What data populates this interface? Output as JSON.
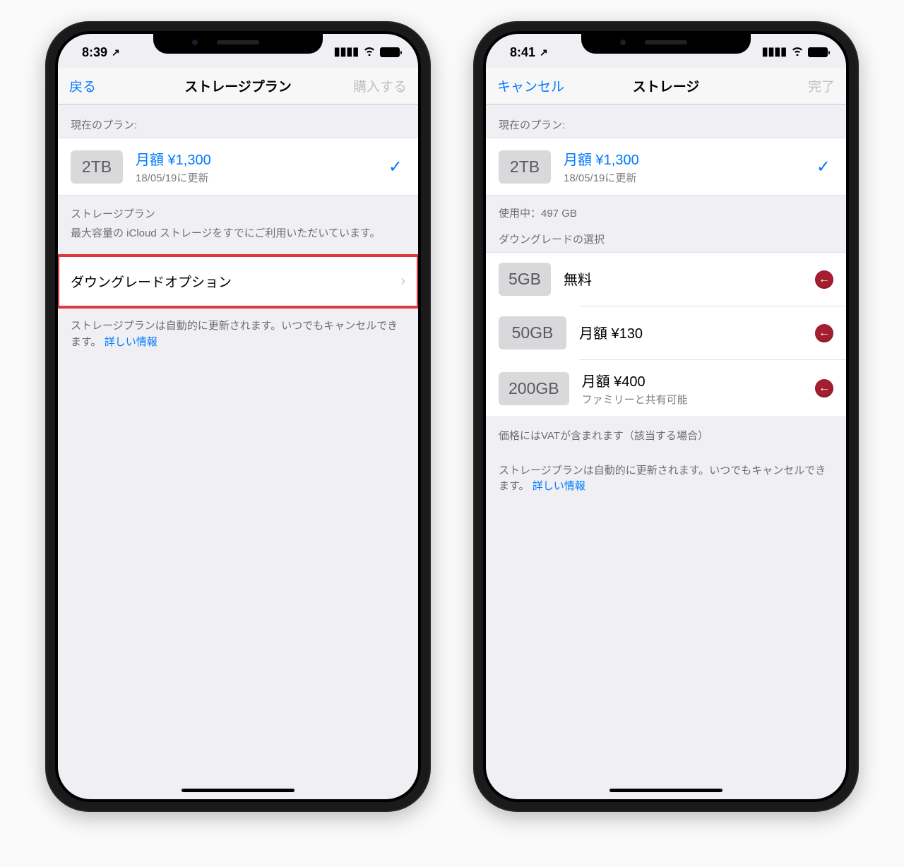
{
  "left": {
    "status": {
      "time": "8:39",
      "loc": "↗"
    },
    "nav": {
      "back": "戻る",
      "title": "ストレージプラン",
      "right": "購入する"
    },
    "currentHeader": "現在のプラン:",
    "current": {
      "size": "2TB",
      "price": "月額 ¥1,300",
      "renew": "18/05/19に更新"
    },
    "storageLabel": "ストレージプラン",
    "storageDesc": "最大容量の iCloud ストレージをすでにご利用いただいています。",
    "downgradeOption": "ダウングレードオプション",
    "footer1": "ストレージプランは自動的に更新されます。いつでもキャンセルできます。",
    "footerLink": "詳しい情報"
  },
  "right": {
    "status": {
      "time": "8:41",
      "loc": "↗"
    },
    "nav": {
      "back": "キャンセル",
      "title": "ストレージ",
      "right": "完了"
    },
    "currentHeader": "現在のプラン:",
    "current": {
      "size": "2TB",
      "price": "月額 ¥1,300",
      "renew": "18/05/19に更新"
    },
    "usage": "使用中：497 GB",
    "downgradeHeader": "ダウングレードの選択",
    "options": [
      {
        "size": "5GB",
        "price": "無料",
        "sub": ""
      },
      {
        "size": "50GB",
        "price": "月額 ¥130",
        "sub": ""
      },
      {
        "size": "200GB",
        "price": "月額 ¥400",
        "sub": "ファミリーと共有可能"
      }
    ],
    "vatNote": "価格にはVATが含まれます（該当する場合）",
    "footer1": "ストレージプランは自動的に更新されます。いつでもキャンセルできます。",
    "footerLink": "詳しい情報"
  }
}
